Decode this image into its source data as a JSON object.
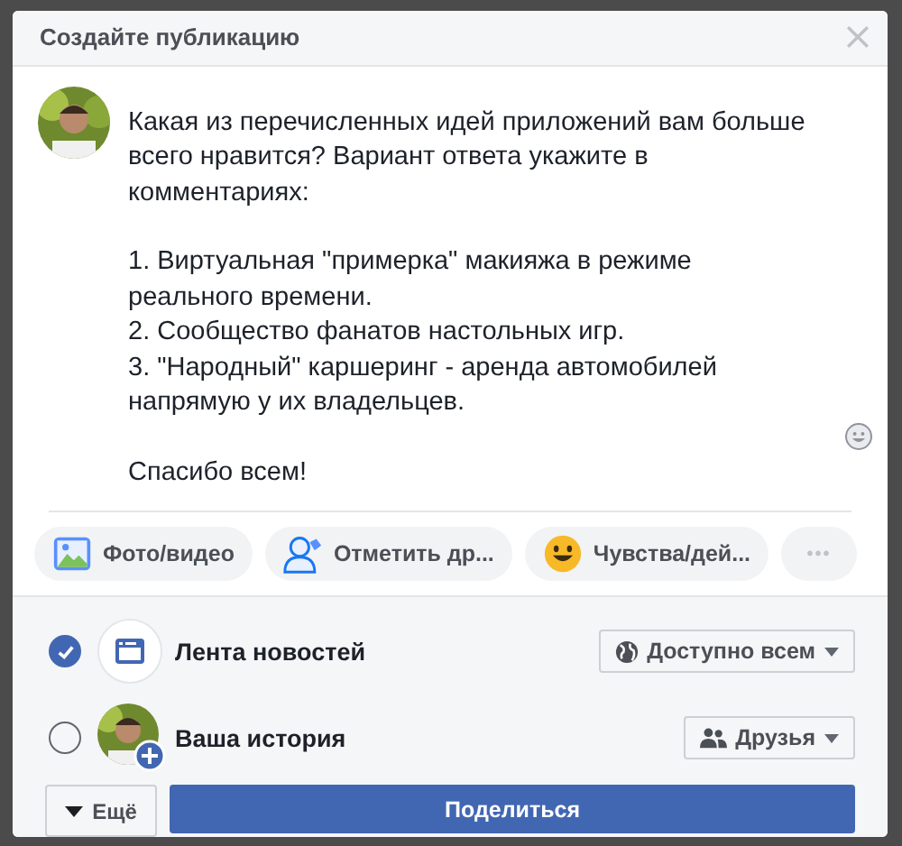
{
  "dialog": {
    "title": "Создайте публикацию"
  },
  "post": {
    "paragraphs": [
      "Какая из перечисленных идей приложений вам больше\nвсего нравится? Вариант ответа укажите в\nкомментариях:",
      "1. Виртуальная \"примерка\" макияжа в режиме\nреального времени.\n2. Сообщество фанатов настольных игр.\n3. \"Народный\" каршеринг - аренда автомобилей\nнапрямую у их владельцев.",
      "Спасибо всем!"
    ]
  },
  "actions": [
    {
      "kind": "photo",
      "label": "Фото/видео"
    },
    {
      "kind": "tag",
      "label": "Отметить др..."
    },
    {
      "kind": "feeling",
      "label": "Чувства/дей..."
    },
    {
      "kind": "more",
      "label": "•••"
    }
  ],
  "destinations": [
    {
      "kind": "feed",
      "label": "Лента новостей",
      "selected": true,
      "audience": {
        "kind": "public",
        "label": "Доступно всем"
      }
    },
    {
      "kind": "story",
      "label": "Ваша история",
      "selected": false,
      "audience": {
        "kind": "friends",
        "label": "Друзья"
      }
    }
  ],
  "more_button": "Ещё",
  "share_button": "Поделиться"
}
